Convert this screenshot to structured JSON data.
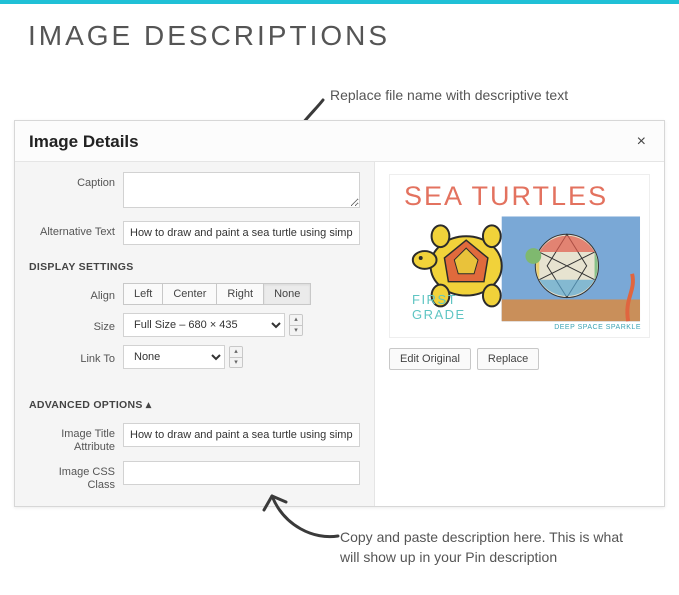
{
  "page_heading": "IMAGE DESCRIPTIONS",
  "annotations": {
    "top": "Replace file name with descriptive text",
    "bottom": "Copy and paste description here. This is what will show up in your Pin description"
  },
  "modal": {
    "title": "Image Details",
    "close_label": "×",
    "caption": {
      "label": "Caption",
      "value": ""
    },
    "alt_text": {
      "label": "Alternative Text",
      "value": "How to draw and paint a sea turtle using simple art suppl"
    },
    "display_settings_heading": "DISPLAY SETTINGS",
    "align": {
      "label": "Align",
      "options": [
        "Left",
        "Center",
        "Right",
        "None"
      ],
      "selected": "None"
    },
    "size": {
      "label": "Size",
      "selected": "Full Size – 680 × 435"
    },
    "link_to": {
      "label": "Link To",
      "selected": "None"
    },
    "advanced_heading": "ADVANCED OPTIONS ▴",
    "title_attr": {
      "label": "Image Title Attribute",
      "value": "How to draw and paint a sea turtle using simple art suppl"
    },
    "css_class": {
      "label": "Image CSS Class",
      "value": ""
    },
    "preview": {
      "headline": "SEA TURTLES",
      "grade_line1": "FIRST",
      "grade_line2": "GRADE",
      "credit": "DEEP SPACE SPARKLE",
      "edit_btn": "Edit Original",
      "replace_btn": "Replace"
    }
  }
}
